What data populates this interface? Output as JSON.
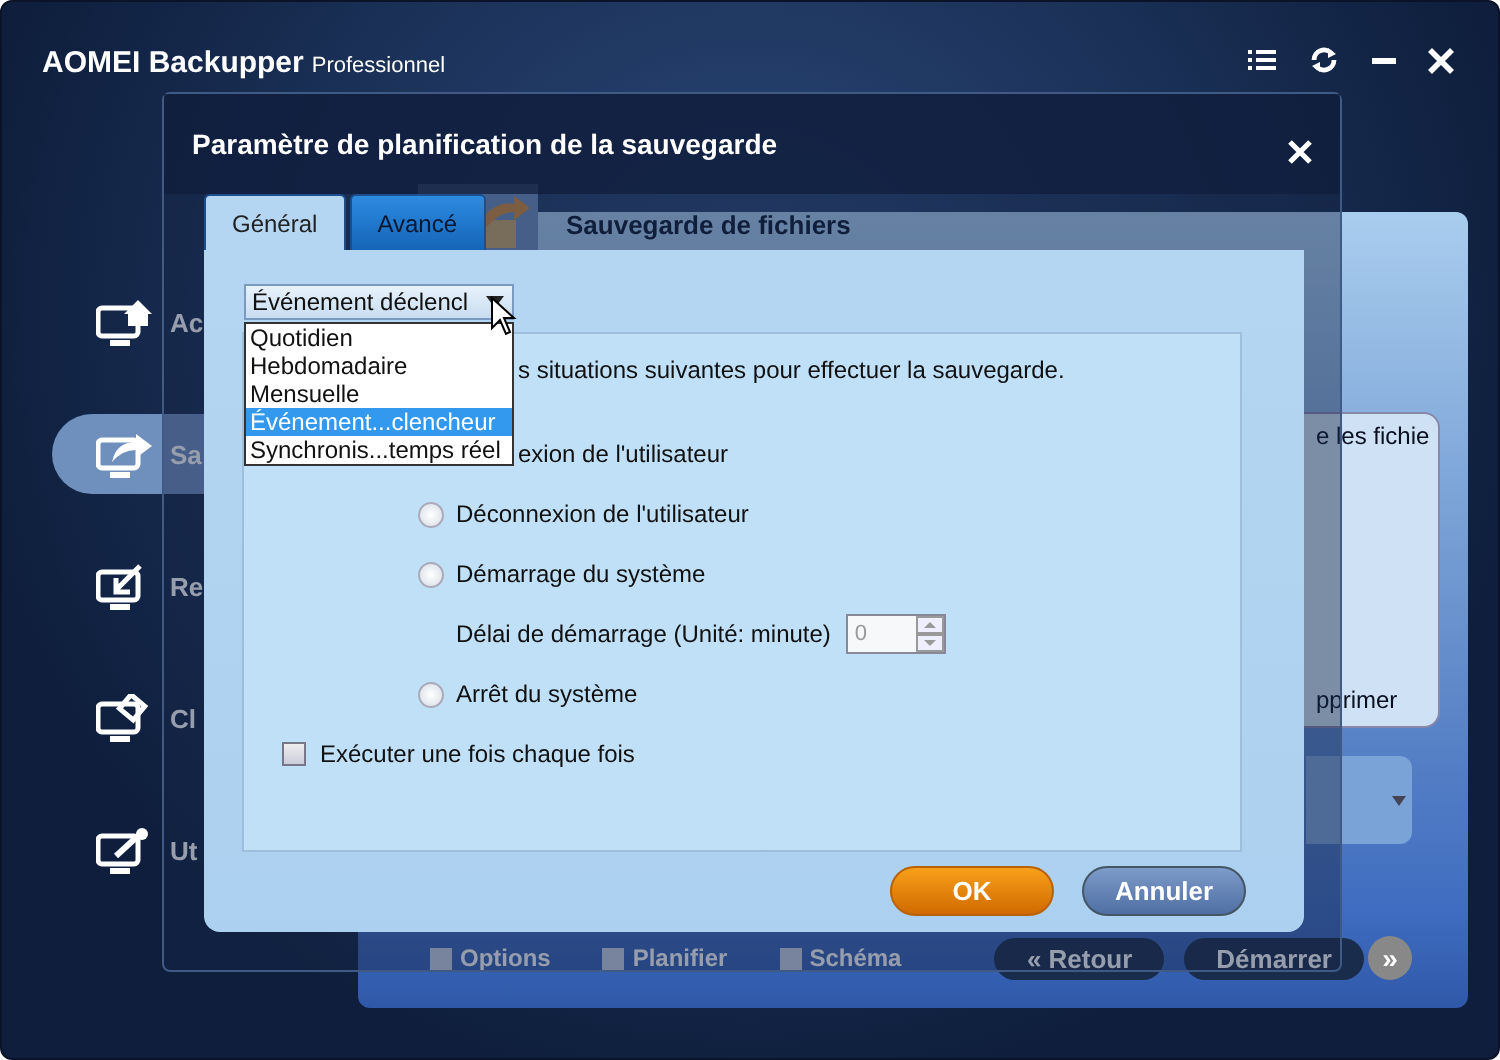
{
  "app": {
    "title": "AOMEI Backupper",
    "edition": "Professionnel"
  },
  "sidebar": {
    "items": [
      {
        "label": "Ac",
        "selected": false
      },
      {
        "label": "Sa",
        "selected": true
      },
      {
        "label": "Re",
        "selected": false
      },
      {
        "label": "Cl",
        "selected": false
      },
      {
        "label": "Ut",
        "selected": false
      }
    ]
  },
  "main": {
    "title": "Sauvegarde de fichiers",
    "source_fragment": "e les fichie",
    "remove_fragment": "pprimer",
    "toolbar": [
      "Options",
      "Planifier",
      "Schéma"
    ],
    "back": "« Retour",
    "start": "Démarrer",
    "next": "»"
  },
  "dialog": {
    "title": "Paramètre de planification de la sauvegarde",
    "tabs": [
      {
        "label": "Général",
        "selected": true
      },
      {
        "label": "Avancé",
        "selected": false
      }
    ],
    "schedule": {
      "value": "Événement déclencl",
      "expanded": true,
      "options": [
        {
          "label": "Quotidien",
          "selected": false
        },
        {
          "label": "Hebdomadaire",
          "selected": false
        },
        {
          "label": "Mensuelle",
          "selected": false
        },
        {
          "label": "Événement...clencheur",
          "selected": true
        },
        {
          "label": "Synchronis...temps réel",
          "selected": false
        }
      ]
    },
    "rows": [
      {
        "kind": "text",
        "text": "s situations suivantes pour effectuer la sauvegarde."
      },
      {
        "kind": "text",
        "text": "exion de l'utilisateur"
      },
      {
        "kind": "radio",
        "label": "Déconnexion de l'utilisateur",
        "selected": false
      },
      {
        "kind": "radio",
        "label": "Démarrage du système",
        "selected": false
      },
      {
        "kind": "spin",
        "label": "Délai de démarrage (Unité: minute)",
        "value": "0",
        "disabled": true
      },
      {
        "kind": "radio",
        "label": "Arrêt du système",
        "selected": false
      },
      {
        "kind": "checkbox",
        "label": "Exécuter une fois chaque fois",
        "checked": false
      }
    ],
    "buttons": [
      {
        "label": "OK",
        "kind": "primary"
      },
      {
        "label": "Annuler",
        "kind": "secondary"
      }
    ]
  }
}
